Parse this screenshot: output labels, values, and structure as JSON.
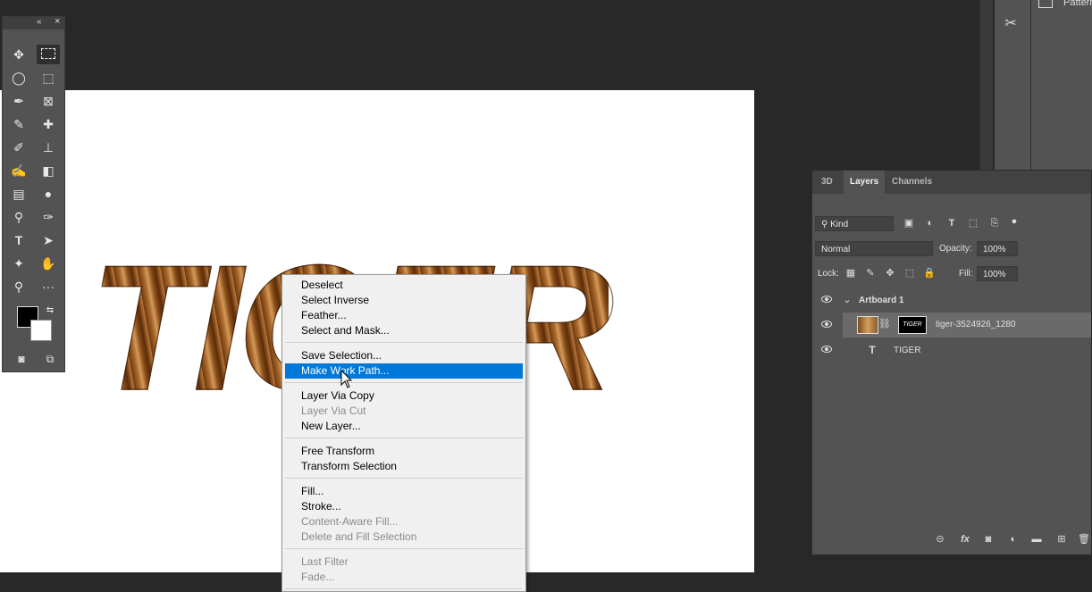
{
  "colors": {
    "accent": "#0078d7",
    "canvas": "#ffffff",
    "panel": "#535353",
    "background": "#282828"
  },
  "top_right": {
    "pattern_label": "Pattern"
  },
  "toolbar": {
    "collapse_glyph": "«",
    "close_glyph": "×",
    "tools": [
      "move-tool",
      "rectangular-marquee-tool",
      "lasso-tool",
      "object-selection-tool",
      "pen-tool",
      "frame-tool",
      "eyedropper-tool",
      "healing-brush-tool",
      "brush-tool",
      "clone-stamp-tool",
      "history-brush-tool",
      "eraser-tool",
      "gradient-tool",
      "blur-tool",
      "dodge-tool",
      "pen-path-tool",
      "type-tool",
      "path-selection-tool",
      "shape-tool",
      "hand-tool",
      "zoom-tool",
      "more-tools"
    ],
    "type_glyph": "T",
    "more_glyph": "···"
  },
  "canvas": {
    "text": "TIGER"
  },
  "context_menu": {
    "groups": [
      [
        {
          "label": "Deselect",
          "enabled": true
        },
        {
          "label": "Select Inverse",
          "enabled": true
        },
        {
          "label": "Feather...",
          "enabled": true
        },
        {
          "label": "Select and Mask...",
          "enabled": true
        }
      ],
      [
        {
          "label": "Save Selection...",
          "enabled": true
        },
        {
          "label": "Make Work Path...",
          "enabled": true,
          "highlighted": true
        }
      ],
      [
        {
          "label": "Layer Via Copy",
          "enabled": true
        },
        {
          "label": "Layer Via Cut",
          "enabled": false
        },
        {
          "label": "New Layer...",
          "enabled": true
        }
      ],
      [
        {
          "label": "Free Transform",
          "enabled": true
        },
        {
          "label": "Transform Selection",
          "enabled": true
        }
      ],
      [
        {
          "label": "Fill...",
          "enabled": true
        },
        {
          "label": "Stroke...",
          "enabled": true
        },
        {
          "label": "Content-Aware Fill...",
          "enabled": false
        },
        {
          "label": "Delete and Fill Selection",
          "enabled": false
        }
      ],
      [
        {
          "label": "Last Filter",
          "enabled": false
        },
        {
          "label": "Fade...",
          "enabled": false
        }
      ]
    ]
  },
  "layers_panel": {
    "tabs": [
      "3D",
      "Layers",
      "Channels"
    ],
    "active_tab": "Layers",
    "filter_kind": "Kind",
    "blend_mode": "Normal",
    "opacity_label": "Opacity:",
    "opacity_value": "100%",
    "lock_label": "Lock:",
    "fill_label": "Fill:",
    "fill_value": "100%",
    "layers": [
      {
        "name": "Artboard 1",
        "type": "artboard"
      },
      {
        "name": "tiger-3524926_1280",
        "type": "image",
        "mask_text": "TIGER"
      },
      {
        "name": "TIGER",
        "type": "text"
      }
    ],
    "footer_icons": [
      "link-icon",
      "fx-icon",
      "mask-icon",
      "adjustment-icon",
      "group-folder-icon",
      "new-layer-icon",
      "trash-icon"
    ]
  }
}
